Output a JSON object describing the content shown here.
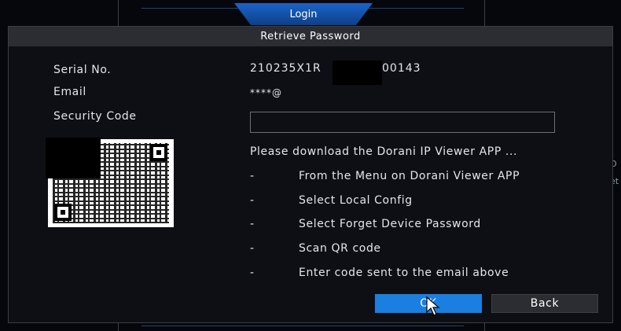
{
  "background": {
    "login_tab": "Login"
  },
  "dialog": {
    "title": "Retrieve Password",
    "fields": {
      "serial_label": "Serial No.",
      "serial_value": "210235X1R",
      "serial_value_suffix": "00143",
      "email_label": "Email",
      "email_value": "****@",
      "security_code_label": "Security Code",
      "security_code_value": ""
    },
    "instructions": {
      "intro": "Please download the Dorani IP Viewer APP ...",
      "dash": "-",
      "steps": [
        "From the Menu on Dorani Viewer APP",
        "Select Local Config",
        "Select Forget Device Password",
        "Scan QR code",
        "Enter code sent to the email above"
      ]
    },
    "buttons": {
      "ok_label": "OK",
      "back_label": "Back"
    }
  },
  "colors": {
    "accent": "#1a7fe0",
    "dialog_bg": "#0e0f14",
    "title_bar": "#2b2d33"
  },
  "icons": {
    "qr": "qr-code-icon",
    "cursor": "mouse-cursor-icon"
  }
}
